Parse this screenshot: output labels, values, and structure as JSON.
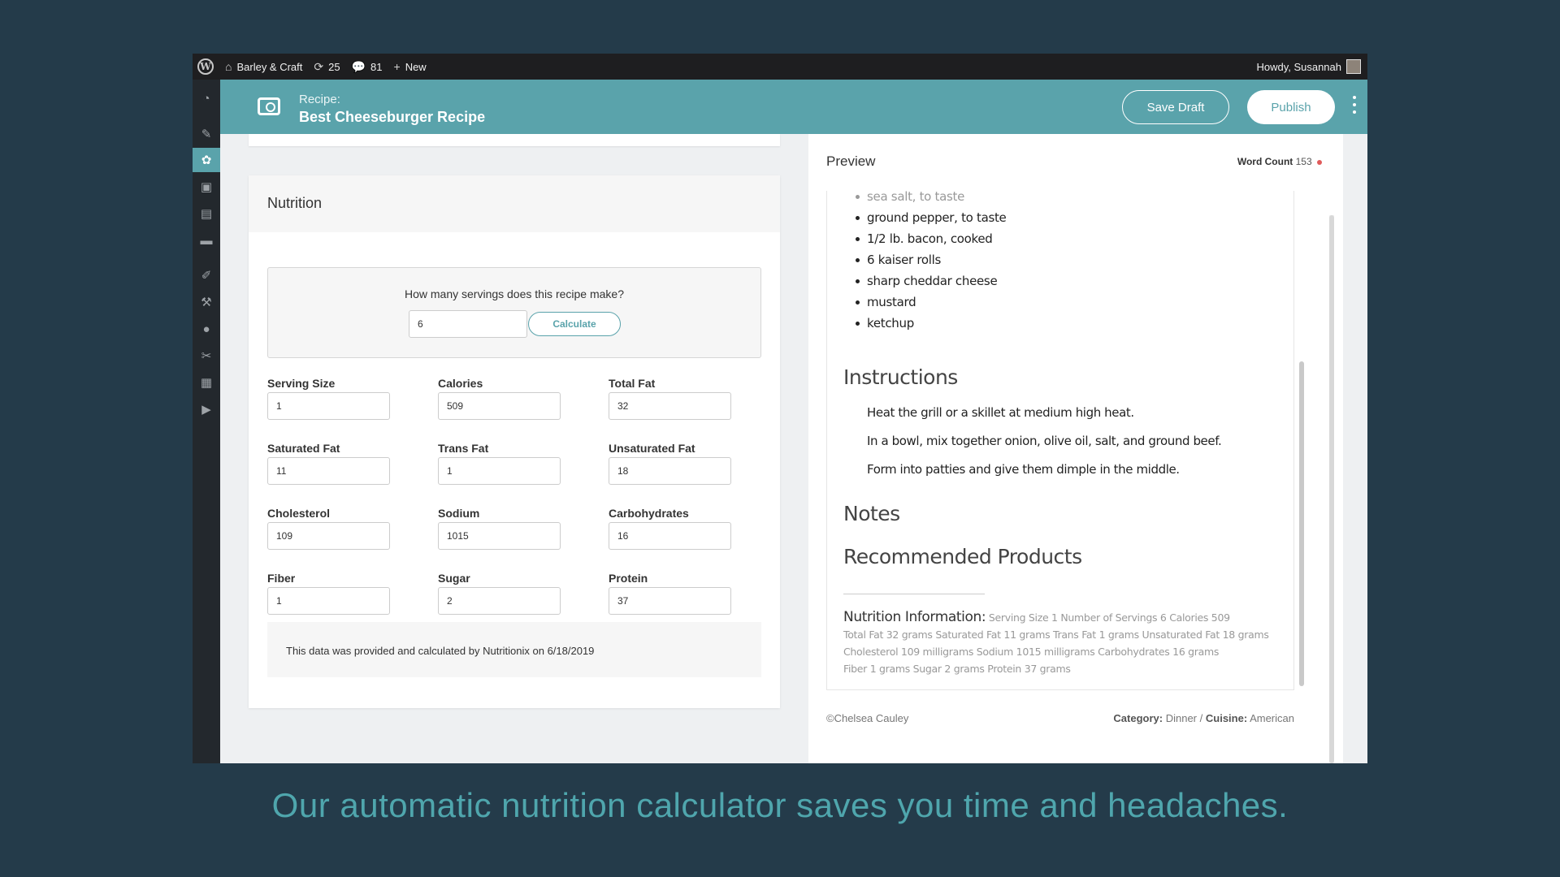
{
  "adminbar": {
    "site_name": "Barley & Craft",
    "updates_count": "25",
    "comments_count": "81",
    "new_label": "New",
    "greeting": "Howdy, Susannah"
  },
  "sidebar": {
    "icons": [
      "dashboard-icon",
      "pin-icon",
      "recipe-icon",
      "media-icon",
      "pages-icon",
      "comments-icon",
      "appearance-icon",
      "plugins-icon",
      "users-icon",
      "tools-icon",
      "settings-icon",
      "play-icon"
    ]
  },
  "header": {
    "label": "Recipe:",
    "title": "Best Cheeseburger Recipe",
    "save_draft": "Save Draft",
    "publish": "Publish"
  },
  "nutrition": {
    "title": "Nutrition",
    "servings_question": "How many servings does this recipe make?",
    "servings_value": "6",
    "calculate_label": "Calculate",
    "fields": [
      {
        "label": "Serving Size",
        "value": "1"
      },
      {
        "label": "Calories",
        "value": "509"
      },
      {
        "label": "Total Fat",
        "value": "32"
      },
      {
        "label": "Saturated Fat",
        "value": "11"
      },
      {
        "label": "Trans Fat",
        "value": "1"
      },
      {
        "label": "Unsaturated Fat",
        "value": "18"
      },
      {
        "label": "Cholesterol",
        "value": "109"
      },
      {
        "label": "Sodium",
        "value": "1015"
      },
      {
        "label": "Carbohydrates",
        "value": "16"
      },
      {
        "label": "Fiber",
        "value": "1"
      },
      {
        "label": "Sugar",
        "value": "2"
      },
      {
        "label": "Protein",
        "value": "37"
      }
    ],
    "note": "This data was provided and calculated by Nutritionix on 6/18/2019"
  },
  "preview": {
    "title": "Preview",
    "word_count_label": "Word Count",
    "word_count": "153",
    "ingredients": [
      "sea salt, to taste",
      "ground pepper, to taste",
      "1/2 lb. bacon, cooked",
      "6 kaiser rolls",
      "sharp cheddar cheese",
      "mustard",
      "ketchup"
    ],
    "instructions_heading": "Instructions",
    "instructions": [
      "Heat the grill or a skillet at medium high heat.",
      "In a bowl, mix together onion, olive oil, salt, and ground beef.",
      "Form into patties and give them dimple in the middle."
    ],
    "notes_heading": "Notes",
    "products_heading": "Recommended Products",
    "nutrition_info_label": "Nutrition Information:",
    "nutrition_info_line1": "Serving Size 1  Number of Servings 6  Calories 509",
    "nutrition_info_line2": "Total Fat 32 grams Saturated Fat 11 grams Trans Fat 1 grams Unsaturated Fat 18 grams",
    "nutrition_info_line3": "Cholesterol 109 milligrams Sodium 1015 milligrams Carbohydrates 16 grams",
    "nutrition_info_line4": "Fiber 1 grams Sugar 2 grams Protein 37 grams",
    "copyright": "©Chelsea Cauley",
    "category_label": "Category:",
    "category": "Dinner",
    "separator": "/",
    "cuisine_label": "Cuisine:",
    "cuisine": "American"
  },
  "caption": "Our automatic nutrition calculator saves you time and headaches.",
  "colors": {
    "accent": "#5aa3ab",
    "background": "#243b4a",
    "caption": "#4fa6ad"
  }
}
